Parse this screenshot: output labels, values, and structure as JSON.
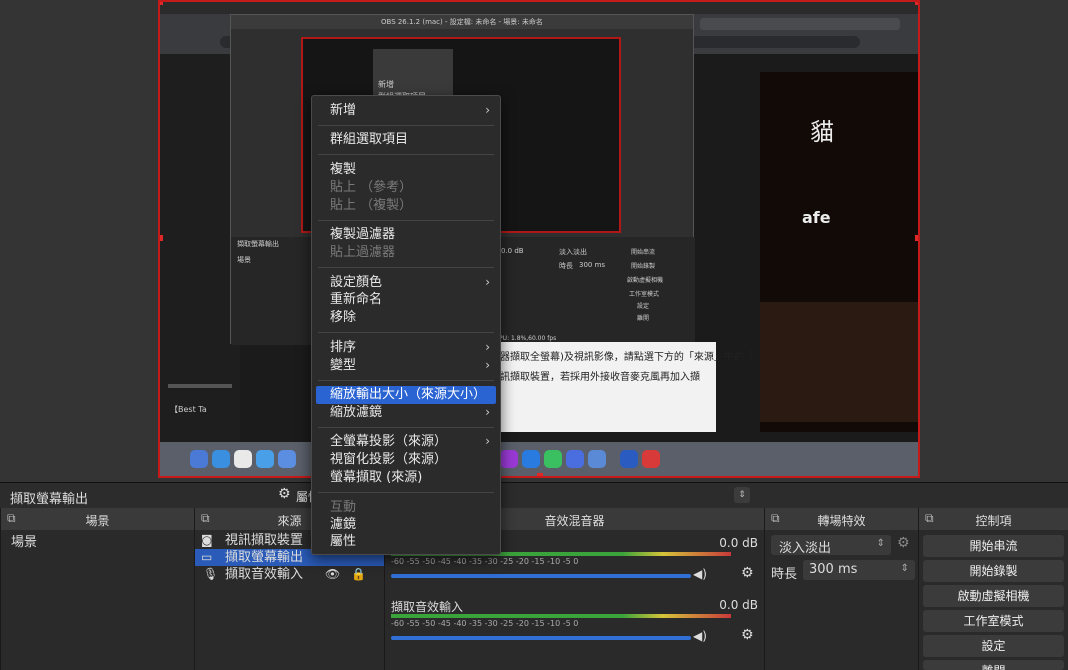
{
  "preview": {
    "inner_title": "OBS 26.1.2 (mac) - 設定檔: 未命名 - 場景: 未命名",
    "web_text_1": "器擷取全螢幕)及視訊影像，請點選下方的「來源」中的「",
    "web_text_2": "訊擷取裝置，若採用外接收音麥克風再加入擷",
    "video_title_fragment": "【Best Ta",
    "cafe_text": "afe",
    "cat_text": "貓",
    "nested_labels": {
      "add": "新增",
      "group": "群組選取項目",
      "fade": "淡入淡出",
      "duration": "時長",
      "dur_val": "300 ms",
      "start_stream": "開始串流",
      "start_rec": "開始錄製",
      "virtual_cam": "啟動虛擬相機",
      "studio": "工作室模式",
      "settings": "設定",
      "exit": "離開",
      "status": "LIVE: 00:00:00  ●  REC: 00:00:00   CPU: 1.8%,60.00 fps",
      "db1": "0.0 dB",
      "capture_out": "擷取螢幕輸出",
      "scene_short": "場景"
    }
  },
  "source_bar": {
    "name": "擷取螢幕輸出",
    "props_label": "屬性"
  },
  "scenes": {
    "header": "場景",
    "items": [
      "場景"
    ]
  },
  "sources": {
    "header": "來源",
    "items": [
      {
        "label": "視訊擷取裝置",
        "icon": "camera-icon"
      },
      {
        "label": "擷取螢幕輸出",
        "icon": "monitor-icon"
      },
      {
        "label": "擷取音效輸入",
        "icon": "microphone-icon"
      }
    ]
  },
  "mixer": {
    "header": "音效混音器",
    "channels": [
      {
        "name": "",
        "db": "0.0 dB"
      },
      {
        "name": "擷取音效輸入",
        "db": "0.0 dB"
      }
    ],
    "ticks": "-60  -55  -50  -45  -40  -35  -30  -25  -20  -15  -10   -5    0"
  },
  "transitions": {
    "header": "轉場特效",
    "selected": "淡入淡出",
    "duration_label": "時長",
    "duration_value": "300 ms"
  },
  "controls": {
    "header": "控制項",
    "buttons": [
      "開始串流",
      "開始錄製",
      "啟動虛擬相機",
      "工作室模式",
      "設定",
      "離開"
    ]
  },
  "context_menu": {
    "add": "新增",
    "group": "群組選取項目",
    "copy": "複製",
    "paste_ref": "貼上 （參考）",
    "paste_dup": "貼上 （複製）",
    "copy_filters": "複製過濾器",
    "paste_filters": "貼上過濾器",
    "set_color": "設定顏色",
    "rename": "重新命名",
    "remove": "移除",
    "order": "排序",
    "transform": "變型",
    "scale_output": "縮放輸出大小（來源大小）",
    "scale_filter": "縮放濾鏡",
    "fullscreen_proj": "全螢幕投影（來源）",
    "window_proj": "視窗化投影（來源）",
    "screenshot": "螢幕擷取 (來源)",
    "interact": "互動",
    "filters": "濾鏡",
    "properties": "屬性"
  },
  "colors": {
    "accent": "#2a63d2",
    "capture_border": "#c41a1a",
    "panel": "#2a2a2a"
  }
}
